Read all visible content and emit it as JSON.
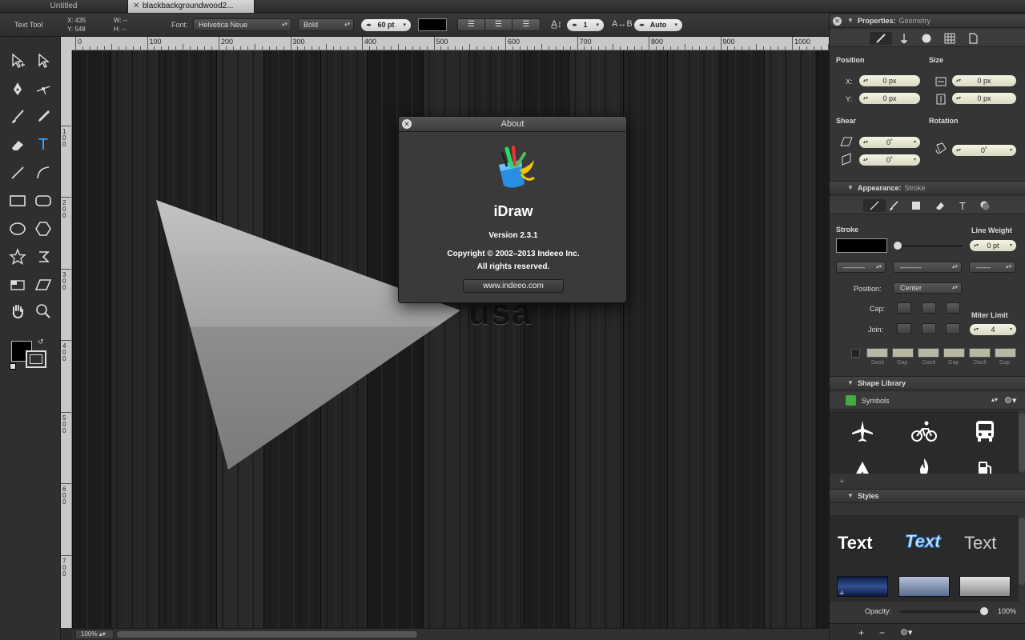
{
  "tabs": [
    {
      "label": "Untitled",
      "active": false
    },
    {
      "label": "blackbackgroundwood2...",
      "active": true
    }
  ],
  "toolbar": {
    "tool_name": "Text Tool",
    "x_label": "X:",
    "x_value": "435",
    "y_label": "Y:",
    "y_value": "548",
    "w_label": "W:",
    "w_value": "--",
    "h_label": "H:",
    "h_value": "--",
    "font_label": "Font:",
    "font_family": "Helvetica Neue",
    "font_style": "Bold",
    "font_size": "60 pt",
    "line_spacing": "1",
    "tracking": "Auto",
    "color": "#000000"
  },
  "ruler": {
    "h_labels": [
      "0",
      "100",
      "200",
      "300",
      "400",
      "500",
      "600",
      "700",
      "800",
      "900",
      "1000"
    ],
    "v_labels": [
      "100",
      "200",
      "300",
      "400",
      "500",
      "600",
      "700"
    ]
  },
  "canvas": {
    "overlay_text": "usa"
  },
  "zoom": "100%",
  "about": {
    "title": "About",
    "app_name": "iDraw",
    "version": "Version 2.3.1",
    "copyright": "Copyright © 2002–2013 Indeeo Inc.",
    "rights": "All rights reserved.",
    "website": "www.indeeo.com"
  },
  "properties": {
    "header": "Properties:",
    "subheader": "Geometry",
    "position_label": "Position",
    "size_label": "Size",
    "x_label": "X:",
    "x_value": "0 px",
    "y_label": "Y:",
    "y_value": "0 px",
    "w_value": "0 px",
    "h_value": "0 px",
    "shear_label": "Shear",
    "rotation_label": "Rotation",
    "shear1": "0˚",
    "shear2": "0˚",
    "rotation": "0˚"
  },
  "appearance": {
    "header": "Appearance:",
    "subheader": "Stroke",
    "stroke_label": "Stroke",
    "line_weight_label": "Line Weight",
    "line_weight": "0 pt",
    "position_label": "Position:",
    "position_value": "Center",
    "cap_label": "Cap:",
    "join_label": "Join:",
    "miter_label": "Miter Limit",
    "miter_value": "4",
    "dash_labels": [
      "Dash",
      "Gap",
      "Dash",
      "Gap",
      "Dash",
      "Gap"
    ]
  },
  "shape_library": {
    "header": "Shape Library",
    "category": "Symbols",
    "icons": [
      "airplane-icon",
      "bicycle-icon",
      "bus-icon",
      "tent-icon",
      "fire-icon",
      "fuel-icon"
    ]
  },
  "styles": {
    "header": "Styles",
    "samples": [
      "Text",
      "Text",
      "Text"
    ]
  },
  "opacity": {
    "label": "Opacity:",
    "value": "100%",
    "level": 1.0
  }
}
